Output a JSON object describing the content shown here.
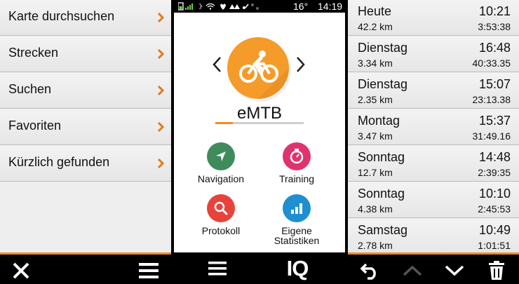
{
  "left_panel": {
    "menu_items": [
      {
        "label": "Karte durchsuchen"
      },
      {
        "label": "Strecken"
      },
      {
        "label": "Suchen"
      },
      {
        "label": "Favoriten"
      },
      {
        "label": "Kürzlich gefunden"
      }
    ],
    "icons": {
      "close": "close-icon",
      "menu": "hamburger-menu-icon"
    }
  },
  "middle_panel": {
    "status_bar": {
      "temperature": "16°",
      "time": "14:19"
    },
    "profile": {
      "name": "eMTB",
      "icon": "bicycle-icon",
      "color": "#f49b2a",
      "progress_fraction": 0.2
    },
    "apps": [
      {
        "label": "Navigation",
        "icon": "navigation-arrow-icon",
        "color": "#3f8b5c"
      },
      {
        "label": "Training",
        "icon": "stopwatch-icon",
        "color": "#e0336d"
      },
      {
        "label": "Protokoll",
        "icon": "magnifier-icon",
        "color": "#e8423c"
      },
      {
        "label": "Eigene Statistiken",
        "icon": "bar-chart-icon",
        "color": "#1f8fd1"
      }
    ],
    "bottom_logo": "IQ"
  },
  "right_panel": {
    "history": [
      {
        "day": "Heute",
        "distance": "42.2 km",
        "time": "10:21",
        "duration": "3:53:38"
      },
      {
        "day": "Dienstag",
        "distance": "3.34 km",
        "time": "16:48",
        "duration": "40:33.35"
      },
      {
        "day": "Dienstag",
        "distance": "2.35 km",
        "time": "15:07",
        "duration": "23:13.38"
      },
      {
        "day": "Montag",
        "distance": "3.47 km",
        "time": "15:37",
        "duration": "31:49.16"
      },
      {
        "day": "Sonntag",
        "distance": "12.7 km",
        "time": "14:48",
        "duration": "2:39:35"
      },
      {
        "day": "Sonntag",
        "distance": "4.38 km",
        "time": "10:10",
        "duration": "2:45:53"
      },
      {
        "day": "Samstag",
        "distance": "2.78 km",
        "time": "10:49",
        "duration": "1:01:51"
      }
    ]
  },
  "accent_color": "#f08a24"
}
